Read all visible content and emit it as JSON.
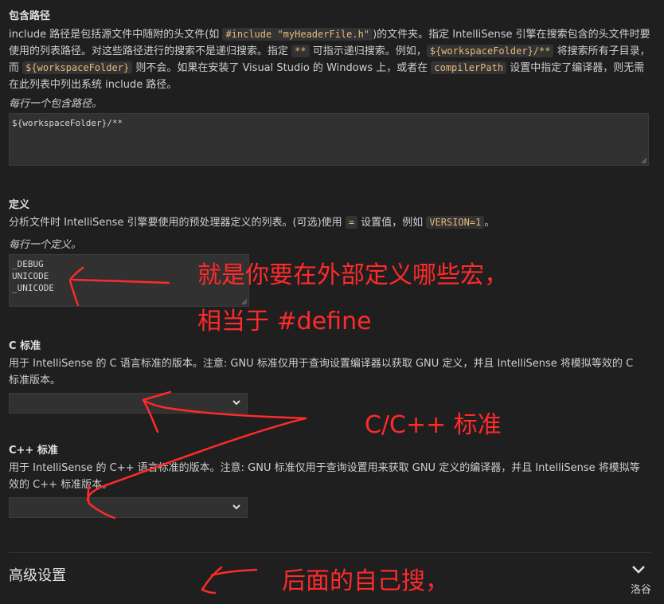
{
  "include_path": {
    "title": "包含路径",
    "desc": {
      "p1": "include 路径是包括源文件中随附的头文件(如 ",
      "code1": "#include \"myHeaderFile.h\"",
      "p2": ")的文件夹。指定 IntelliSense 引擎在搜索包含的头文件时要使用的列表路径。对这些路径进行的搜索不是递归搜索。指定 ",
      "code2": "**",
      "p3": " 可指示递归搜索。例如，",
      "code3": "${workspaceFolder}/**",
      "p4": " 将搜索所有子目录，而 ",
      "code4": "${workspaceFolder}",
      "p5": " 则不会。如果在安装了 Visual Studio 的 Windows 上，或者在 ",
      "code5": "compilerPath",
      "p6": " 设置中指定了编译器，则无需在此列表中列出系统 include 路径。"
    },
    "hint": "每行一个包含路径。",
    "value": "${workspaceFolder}/**"
  },
  "defines": {
    "title": "定义",
    "desc": {
      "p1": "分析文件时 IntelliSense 引擎要使用的预处理器定义的列表。(可选)使用 ",
      "code1": "=",
      "p2": " 设置值，例如 ",
      "code2": "VERSION=1",
      "p3": "。"
    },
    "hint": "每行一个定义。",
    "lines": [
      "_DEBUG",
      "UNICODE",
      "_UNICODE"
    ]
  },
  "c_standard": {
    "title": "C 标准",
    "desc": "用于 IntelliSense 的 C 语言标准的版本。注意: GNU 标准仅用于查询设置编译器以获取 GNU 定义，并且 IntelliSense 将模拟等效的 C 标准版本。",
    "selected": ""
  },
  "cpp_standard": {
    "title": "C++ 标准",
    "desc": "用于 IntelliSense 的 C++ 语言标准的版本。注意: GNU 标准仅用于查询设置用来获取 GNU 定义的编译器，并且 IntelliSense 将模拟等效的 C++ 标准版本。",
    "selected": ""
  },
  "advanced": {
    "title": "高级设置"
  },
  "annotations": {
    "note1_line1": "就是你要在外部定义哪些宏，",
    "note1_line2": "相当于 #define",
    "note2": "C/C++ 标准",
    "note3": "后面的自己搜，"
  },
  "watermark": "洛谷",
  "colors": {
    "background": "#1f1f1f",
    "annotation": "#ff2a2a",
    "code_text": "#e6b97a"
  }
}
